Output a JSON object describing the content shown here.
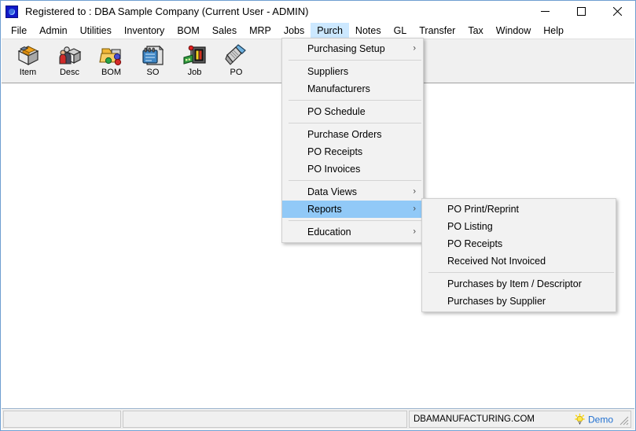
{
  "window": {
    "title": "Registered to : DBA Sample Company (Current User - ADMIN)",
    "app_icon": "app-logo-icon",
    "controls": {
      "minimize": "minimize-icon",
      "maximize": "maximize-icon",
      "close": "close-icon"
    }
  },
  "menubar": {
    "items": [
      {
        "label": "File",
        "active": false
      },
      {
        "label": "Admin",
        "active": false
      },
      {
        "label": "Utilities",
        "active": false
      },
      {
        "label": "Inventory",
        "active": false
      },
      {
        "label": "BOM",
        "active": false
      },
      {
        "label": "Sales",
        "active": false
      },
      {
        "label": "MRP",
        "active": false
      },
      {
        "label": "Jobs",
        "active": false
      },
      {
        "label": "Purch",
        "active": true
      },
      {
        "label": "Notes",
        "active": false
      },
      {
        "label": "GL",
        "active": false
      },
      {
        "label": "Transfer",
        "active": false
      },
      {
        "label": "Tax",
        "active": false
      },
      {
        "label": "Window",
        "active": false
      },
      {
        "label": "Help",
        "active": false
      }
    ]
  },
  "toolbar": {
    "buttons": [
      {
        "label": "Item",
        "icon": "box-crate-icon"
      },
      {
        "label": "Desc",
        "icon": "people-box-icon"
      },
      {
        "label": "BOM",
        "icon": "folder-spheres-icon"
      },
      {
        "label": "SO",
        "icon": "blue-notepad-icon"
      },
      {
        "label": "Job",
        "icon": "machine-panel-icon"
      },
      {
        "label": "PO",
        "icon": "scanner-icon"
      }
    ]
  },
  "purch_menu": {
    "items": [
      {
        "label": "Purchasing Setup",
        "submenu": true,
        "separator_after": true,
        "highlight": false
      },
      {
        "label": "Suppliers",
        "submenu": false,
        "separator_after": false,
        "highlight": false
      },
      {
        "label": "Manufacturers",
        "submenu": false,
        "separator_after": true,
        "highlight": false
      },
      {
        "label": "PO Schedule",
        "submenu": false,
        "separator_after": true,
        "highlight": false
      },
      {
        "label": "Purchase Orders",
        "submenu": false,
        "separator_after": false,
        "highlight": false
      },
      {
        "label": "PO Receipts",
        "submenu": false,
        "separator_after": false,
        "highlight": false
      },
      {
        "label": "PO Invoices",
        "submenu": false,
        "separator_after": true,
        "highlight": false
      },
      {
        "label": "Data Views",
        "submenu": true,
        "separator_after": false,
        "highlight": false
      },
      {
        "label": "Reports",
        "submenu": true,
        "separator_after": true,
        "highlight": true
      },
      {
        "label": "Education",
        "submenu": true,
        "separator_after": false,
        "highlight": false
      }
    ]
  },
  "reports_submenu": {
    "items": [
      {
        "label": "PO Print/Reprint",
        "separator_after": false
      },
      {
        "label": "PO Listing",
        "separator_after": false
      },
      {
        "label": "PO Receipts",
        "separator_after": false
      },
      {
        "label": "Received Not Invoiced",
        "separator_after": true
      },
      {
        "label": "Purchases by Item / Descriptor",
        "separator_after": false
      },
      {
        "label": "Purchases by Supplier",
        "separator_after": false
      }
    ]
  },
  "statusbar": {
    "panel1": "",
    "panel2": "",
    "website": "DBAMANUFACTURING.COM",
    "demo_label": "Demo",
    "demo_icon": "lightbulb-icon",
    "resize_grip": "resize-grip-icon"
  },
  "colors": {
    "menu_highlight": "#91c9f7",
    "menubar_active": "#cce8ff",
    "window_border": "#6f9ed1",
    "toolbar_bg": "#f0f0f0",
    "demo_text": "#1f6fd0",
    "lightbulb": "#ffd900"
  }
}
